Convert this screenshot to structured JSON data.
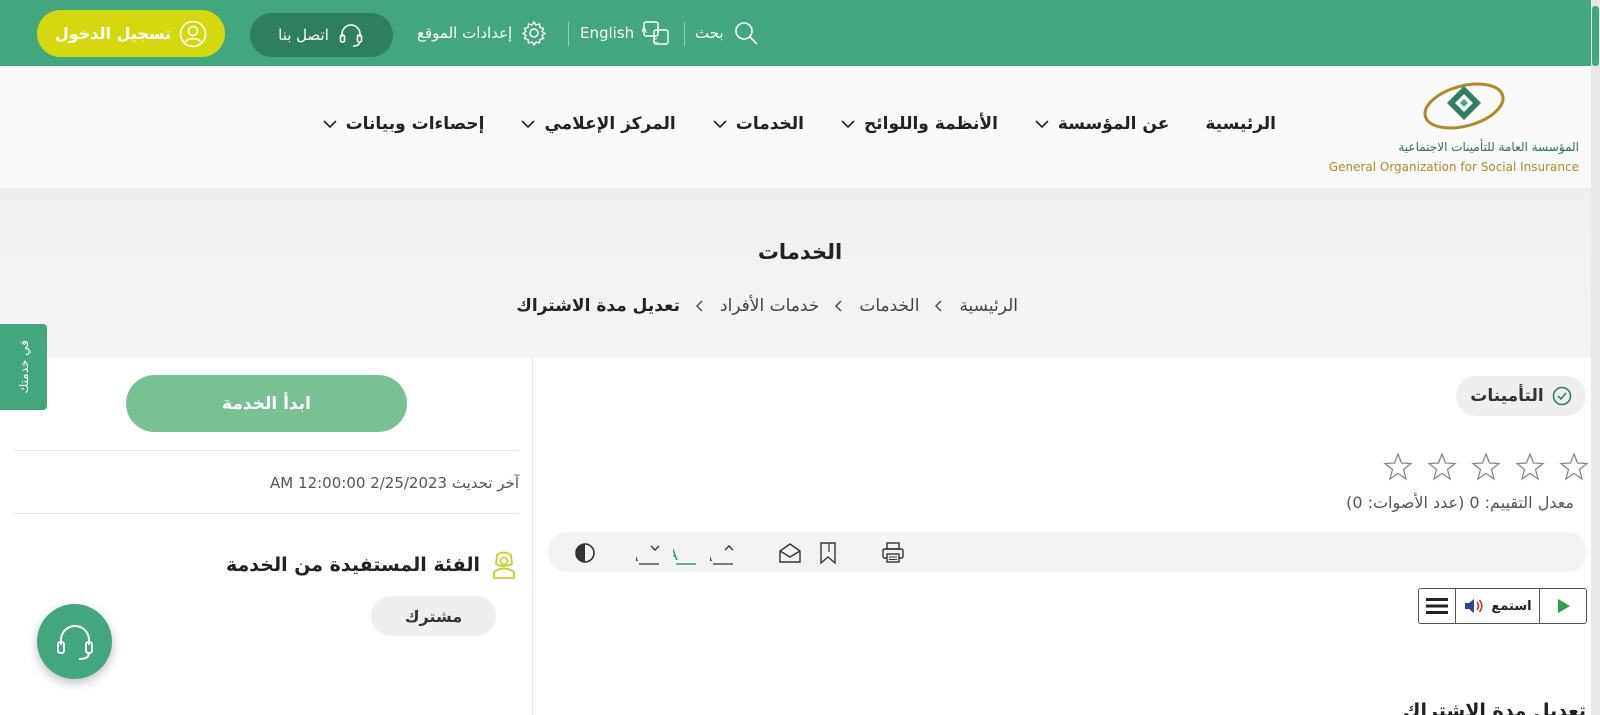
{
  "topbar": {
    "login_label": "تسجيل الدخول",
    "contact_label": "اتصل بنا",
    "settings_label": "إعدادات الموقع",
    "language_label": "English",
    "search_label": "بحث"
  },
  "logo": {
    "name_ar": "المؤسسة العامة للتأمينات الاجتماعية",
    "name_en": "General Organization for Social Insurance"
  },
  "nav": {
    "items": [
      {
        "label": "الرئيسية"
      },
      {
        "label": "عن المؤسسة"
      },
      {
        "label": "الأنظمة واللوائح"
      },
      {
        "label": "الخدمات"
      },
      {
        "label": "المركز الإعلامي"
      },
      {
        "label": "إحصاءات وبيانات"
      }
    ]
  },
  "page": {
    "title": "الخدمات",
    "breadcrumb": [
      "الرئيسية",
      "الخدمات",
      "خدمات الأفراد",
      "تعديل مدة الاشتراك"
    ]
  },
  "side_tab": {
    "label": "في خدمتك"
  },
  "service": {
    "category": "التأمينات",
    "rating": {
      "stars_filled": 0,
      "stars_total": 5,
      "text": "معدل التقييم: 0 (عدد الأصوات: 0)"
    },
    "audio": {
      "listen_label": "استمع"
    },
    "content_title": "تعديل مدة الاشتراك"
  },
  "aside": {
    "start_label": "ابدأ الخدمة",
    "updated_text": "آخر تحديث 2/25/2023 12:00:00 AM",
    "beneficiary_title": "الفئة المستفيدة من الخدمة",
    "beneficiary_chip": "مشترك"
  },
  "colors": {
    "brand_green": "#42a67f",
    "login_yellow": "#d6d80f",
    "contact_dark": "#2e7f5f",
    "start_button": "#78c194"
  },
  "icons": [
    "user-icon",
    "headset-icon",
    "gear-icon",
    "translate-icon",
    "search-icon",
    "chevron-down-icon",
    "chevron-left-icon",
    "check-circle-icon",
    "star-icon",
    "contrast-icon",
    "font-decrease-icon",
    "font-color-icon",
    "font-increase-icon",
    "email-icon",
    "bookmark-icon",
    "print-icon",
    "menu-icon",
    "speaker-icon",
    "play-icon",
    "beneficiary-icon"
  ]
}
